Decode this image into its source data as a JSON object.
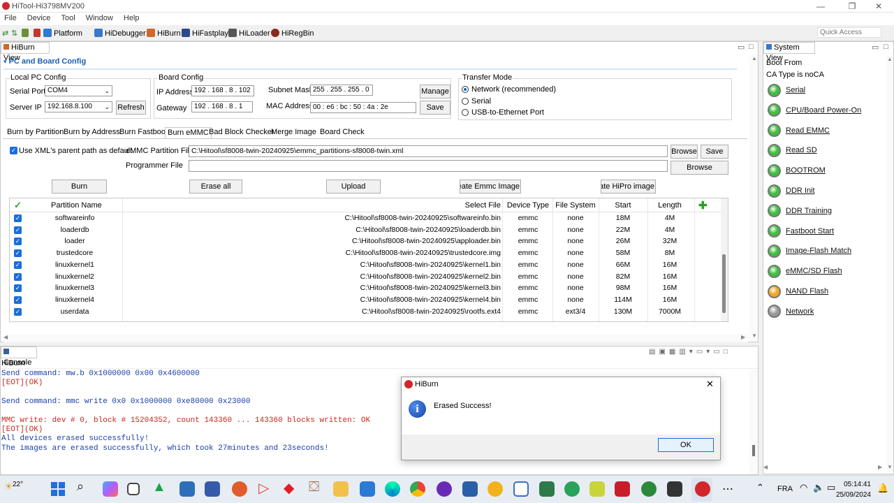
{
  "window": {
    "title": "HiTool-Hi3798MV200",
    "controls": [
      "—",
      "❐",
      "✕"
    ]
  },
  "menu": [
    "File",
    "Device",
    "Tool",
    "Window",
    "Help"
  ],
  "toolbar": {
    "items": [
      "Platform",
      "HiDebugger",
      "HiBurn",
      "HiFastplay",
      "HiLoader",
      "HiRegBin"
    ],
    "quick_access": "Quick Access"
  },
  "hiburn_view": {
    "title": "HiBurn View",
    "section": "PC and Board Config"
  },
  "local_pc": {
    "title": "Local PC Config",
    "serial_port_label": "Serial Port",
    "serial_port": "COM4",
    "server_ip_label": "Server IP",
    "server_ip": "192.168.8.100",
    "refresh": "Refresh"
  },
  "board": {
    "title": "Board Config",
    "ip_label": "IP Address",
    "ip": "192 . 168 . 8 . 102",
    "gateway_label": "Gateway",
    "gateway": "192 . 168 . 8 . 1",
    "subnet_label": "Subnet Mask",
    "subnet": "255 . 255 . 255 . 0",
    "mac_label": "MAC Address",
    "mac": "00 : e6 : bc : 50 : 4a : 2e",
    "manage": "Manage",
    "save": "Save"
  },
  "transfer": {
    "title": "Transfer Mode",
    "options": [
      "Network (recommended)",
      "Serial",
      "USB-to-Ethernet Port"
    ],
    "selected": 0
  },
  "tabs": [
    "Burn by Partition",
    "Burn by Address",
    "Burn Fastboot",
    "Burn eMMC",
    "Bad Block Checker",
    "Merge Image",
    "Board Check"
  ],
  "emmc": {
    "use_xml_label": "Use XML's parent path as default",
    "partition_file_label": "eMMC Partition File",
    "partition_file": "C:\\Hitool\\sf8008-twin-20240925\\emmc_partitions-sf8008-twin.xml",
    "browse": "Browse",
    "save": "Save",
    "programmer_label": "Programmer File",
    "programmer_file": "",
    "browse2": "Browse",
    "actions": {
      "burn": "Burn",
      "erase": "Erase all",
      "upload": "Upload",
      "create_emmc": "Create Emmc Image",
      "create_hipro": "Create HiPro image"
    }
  },
  "table": {
    "columns": [
      "Partition Name",
      "Select File",
      "Device Type",
      "File System",
      "Start",
      "Length"
    ],
    "rows": [
      {
        "name": "softwareinfo",
        "file": "C:\\Hitool\\sf8008-twin-20240925\\softwareinfo.bin",
        "type": "emmc",
        "fs": "none",
        "start": "18M",
        "length": "4M"
      },
      {
        "name": "loaderdb",
        "file": "C:\\Hitool\\sf8008-twin-20240925\\loaderdb.bin",
        "type": "emmc",
        "fs": "none",
        "start": "22M",
        "length": "4M"
      },
      {
        "name": "loader",
        "file": "C:\\Hitool\\sf8008-twin-20240925\\apploader.bin",
        "type": "emmc",
        "fs": "none",
        "start": "26M",
        "length": "32M"
      },
      {
        "name": "trustedcore",
        "file": "C:\\Hitool\\sf8008-twin-20240925\\trustedcore.img",
        "type": "emmc",
        "fs": "none",
        "start": "58M",
        "length": "8M"
      },
      {
        "name": "linuxkernel1",
        "file": "C:\\Hitool\\sf8008-twin-20240925\\kernel1.bin",
        "type": "emmc",
        "fs": "none",
        "start": "66M",
        "length": "16M"
      },
      {
        "name": "linuxkernel2",
        "file": "C:\\Hitool\\sf8008-twin-20240925\\kernel2.bin",
        "type": "emmc",
        "fs": "none",
        "start": "82M",
        "length": "16M"
      },
      {
        "name": "linuxkernel3",
        "file": "C:\\Hitool\\sf8008-twin-20240925\\kernel3.bin",
        "type": "emmc",
        "fs": "none",
        "start": "98M",
        "length": "16M"
      },
      {
        "name": "linuxkernel4",
        "file": "C:\\Hitool\\sf8008-twin-20240925\\kernel4.bin",
        "type": "emmc",
        "fs": "none",
        "start": "114M",
        "length": "16M"
      },
      {
        "name": "userdata",
        "file": "C:\\Hitool\\sf8008-twin-20240925\\rootfs.ext4",
        "type": "emmc",
        "fs": "ext3/4",
        "start": "130M",
        "length": "7000M"
      }
    ]
  },
  "console": {
    "title": "Console",
    "subtitle": "HiBurn",
    "lines": [
      {
        "text": "Send command:   mw.b 0x1000000 0x00 0x4600000",
        "color": "#1a3fa8"
      },
      {
        "text": "[EOT](OK)",
        "color": "#c8281e"
      },
      {
        "text": "",
        "color": "#000"
      },
      {
        "text": "Send command:   mmc write 0x0 0x1000000 0xe80000 0x23000",
        "color": "#1a3fa8"
      },
      {
        "text": "",
        "color": "#000"
      },
      {
        "text": "MMC write: dev # 0, block # 15204352, count 143360 ... 143360 blocks written: OK",
        "color": "#c8281e"
      },
      {
        "text": "[EOT](OK)",
        "color": "#c8281e"
      },
      {
        "text": "All devices erased successfully!",
        "color": "#1a3fa8"
      },
      {
        "text": "The images are erased successfully, which took 27minutes and 23seconds!",
        "color": "#1a3fa8"
      }
    ]
  },
  "dialog": {
    "title": "HiBurn",
    "message": "Erased Success!",
    "ok": "OK",
    "close": "✕"
  },
  "system_view": {
    "title": "System View",
    "boot_from": "Boot From",
    "ca_type": "CA Type is  noCA",
    "items": [
      {
        "label": "Serial",
        "state": "green"
      },
      {
        "label": "CPU/Board Power-On",
        "state": "green"
      },
      {
        "label": "Read EMMC",
        "state": "green"
      },
      {
        "label": "Read SD ",
        "state": "green"
      },
      {
        "label": "BOOTROM",
        "state": "green"
      },
      {
        "label": "DDR Init",
        "state": "green"
      },
      {
        "label": "DDR Training",
        "state": "green"
      },
      {
        "label": "Fastboot Start",
        "state": "green"
      },
      {
        "label": "Image-Flash Match",
        "state": "green"
      },
      {
        "label": "eMMC/SD Flash",
        "state": "green"
      },
      {
        "label": "NAND Flash",
        "state": "orange"
      },
      {
        "label": "Network",
        "state": "gray"
      }
    ],
    "colors": {
      "green": "#3fbf3f",
      "orange": "#f2a623",
      "gray": "#9a9a9a"
    }
  },
  "taskbar": {
    "weather": "22°",
    "lang": "FRA",
    "time": "05:14:41",
    "date": "25/09/2024"
  }
}
